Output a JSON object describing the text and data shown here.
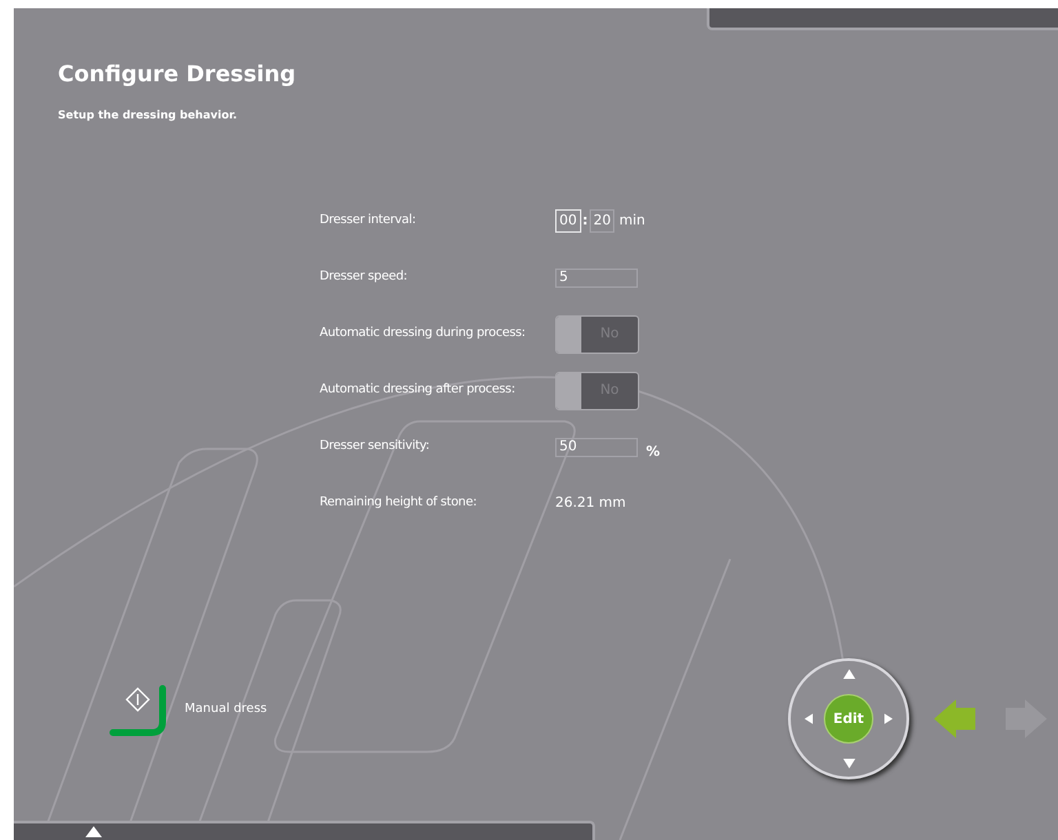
{
  "header": {
    "title": "Configure Dressing",
    "subtitle": "Setup the dressing behavior."
  },
  "fields": [
    {
      "kind": "time",
      "label": "Dresser interval:",
      "segments": [
        {
          "value": "00",
          "selected": true
        },
        {
          "value": "20",
          "selected": false
        }
      ],
      "separator": ":",
      "unit": "min"
    },
    {
      "kind": "text",
      "label": "Dresser speed:",
      "value": "5"
    },
    {
      "kind": "toggle",
      "label": "Automatic dressing during process:",
      "value": "No",
      "on": false
    },
    {
      "kind": "toggle",
      "label": "Automatic dressing after process:",
      "value": "No",
      "on": false
    },
    {
      "kind": "text",
      "label": "Dresser sensitivity:",
      "value": "50",
      "unit": "%"
    },
    {
      "kind": "readout",
      "label": "Remaining height of stone:",
      "value": "26.21 mm"
    }
  ],
  "manual_dress": {
    "label": "Manual dress"
  },
  "navigation": {
    "center_label": "Edit",
    "back_enabled": true,
    "forward_enabled": false
  }
}
